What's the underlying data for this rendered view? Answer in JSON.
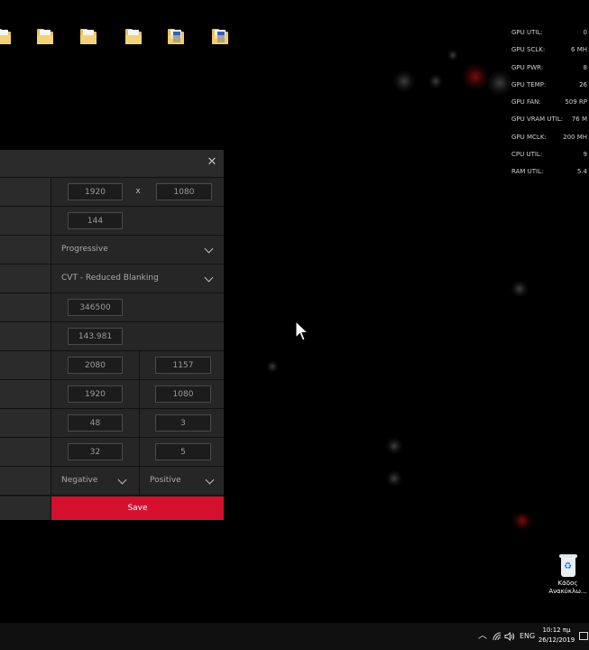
{
  "overlay": {
    "rows": [
      {
        "label": "GPU UTIL:",
        "value": "0"
      },
      {
        "label": "GPU SCLK:",
        "value": "6 MH"
      },
      {
        "label": "GPU PWR:",
        "value": "8"
      },
      {
        "label": "GPU TEMP:",
        "value": "26"
      },
      {
        "label": "GPU FAN:",
        "value": "509 RP"
      },
      {
        "label": "GPU VRAM UTIL:",
        "value": "76 M"
      },
      {
        "label": "GPU MCLK:",
        "value": "200 MH"
      },
      {
        "label": "CPU UTIL:",
        "value": "9"
      },
      {
        "label": "RAM UTIL:",
        "value": "5.4"
      }
    ]
  },
  "dialog": {
    "close_icon": "close-icon",
    "resolution": {
      "width": "1920",
      "sep": "x",
      "height": "1080"
    },
    "refresh_rate": "144",
    "scan_type": "Progressive",
    "timing_standard": "CVT - Reduced Blanking",
    "pixel_clock": "346500",
    "effective_refresh": "143.981",
    "total": {
      "h": "2080",
      "v": "1157"
    },
    "active": {
      "h": "1920",
      "v": "1080"
    },
    "front_porch": {
      "h": "48",
      "v": "3"
    },
    "sync_width": {
      "h": "32",
      "v": "5"
    },
    "polarity": {
      "h": "Negative",
      "v": "Positive"
    },
    "save_label": "Save",
    "accent": "#d5102f"
  },
  "recycle_bin": {
    "label_line1": "Κάδος",
    "label_line2": "Ανακύκλω..."
  },
  "taskbar": {
    "lang": "ENG",
    "time": "10:12 πμ",
    "date": "26/12/2019"
  }
}
